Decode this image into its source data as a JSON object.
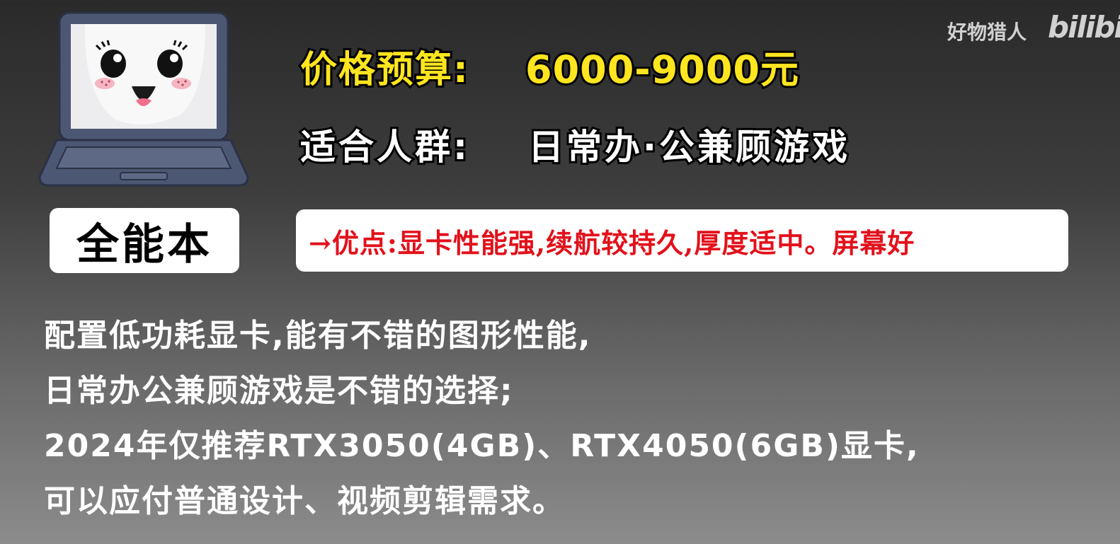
{
  "watermark": {
    "text": "好物猎人",
    "logo": "bilibi"
  },
  "header": {
    "price_label": "价格预算:",
    "price_value": "6000-9000元",
    "audience_label": "适合人群:",
    "audience_value": "日常办·公兼顾游戏"
  },
  "badge": {
    "label": "全能本"
  },
  "pros": {
    "text": "→优点:显卡性能强,续航较持久,厚度适中。屏幕好"
  },
  "description": {
    "lines": [
      "配置低功耗显卡,能有不错的图形性能,",
      "日常办公兼顾游戏是不错的选择;",
      "2024年仅推荐RTX3050(4GB)、RTX4050(6GB)显卡,",
      "可以应付普通设计、视频剪辑需求。"
    ]
  },
  "colors": {
    "highlight": "#ffe51f",
    "pros_text": "#e2111b",
    "badge_bg": "#ffffff"
  },
  "icons": {
    "mascot": "laptop-face-icon"
  }
}
